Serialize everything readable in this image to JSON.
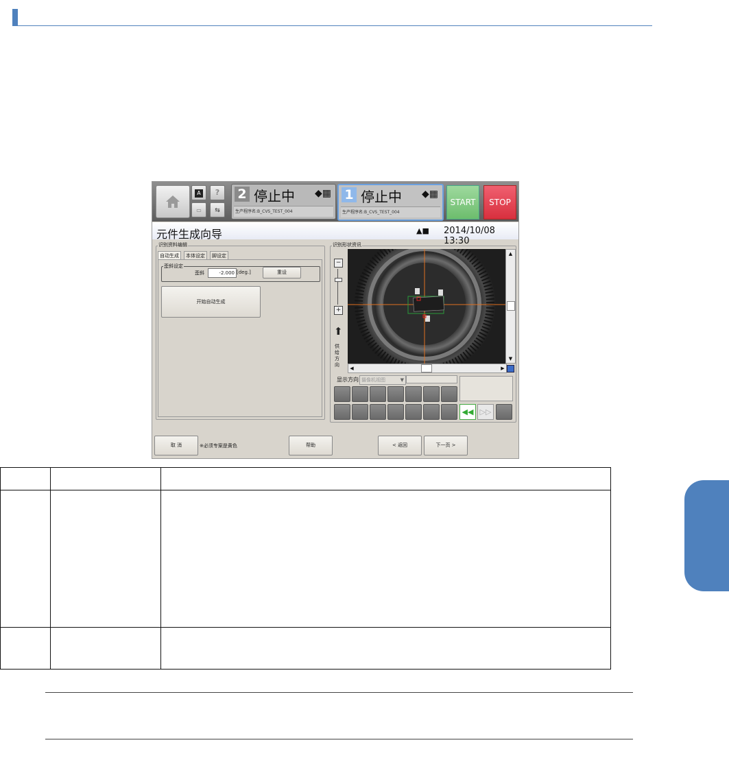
{
  "app": {
    "left_small_buttons": [
      "A",
      "?"
    ],
    "lane2": {
      "number": "2",
      "status": "停止中",
      "program": "生产程序名:B_CVS_TEST_004"
    },
    "lane1": {
      "number": "1",
      "status": "停止中",
      "program": "生产程序名:B_CVS_TEST_004"
    },
    "start_label": "START",
    "stop_label": "STOP",
    "window_title": "元件生成向导",
    "datetime": "2014/10/08 13:30"
  },
  "left_panel": {
    "group_title": "识别资料编辑",
    "tabs": [
      "自动生成",
      "本体设定",
      "脚设定"
    ],
    "tilt_group_title": "歪斜设定",
    "tilt_label": "歪斜",
    "tilt_value": "-2.000",
    "tilt_unit": "[deg.]",
    "reset_label": "重设",
    "auto_start_label": "开始自动生成"
  },
  "right_panel": {
    "group_title": "识别形状资讯",
    "feed_direction": [
      "供",
      "给",
      "方",
      "向"
    ],
    "display_direction_label": "显示方向",
    "display_direction_value": "摄像机视图"
  },
  "footer": {
    "cancel_label": "取 消",
    "note": "※必须专案是黄色",
    "help_label": "帮助",
    "back_label": "< 返回",
    "next_label": "下一页 >"
  },
  "colors": {
    "accent": "#4f81bd",
    "start_green": "#7cc67c",
    "stop_red": "#e04050",
    "crosshair": "#e07020"
  }
}
